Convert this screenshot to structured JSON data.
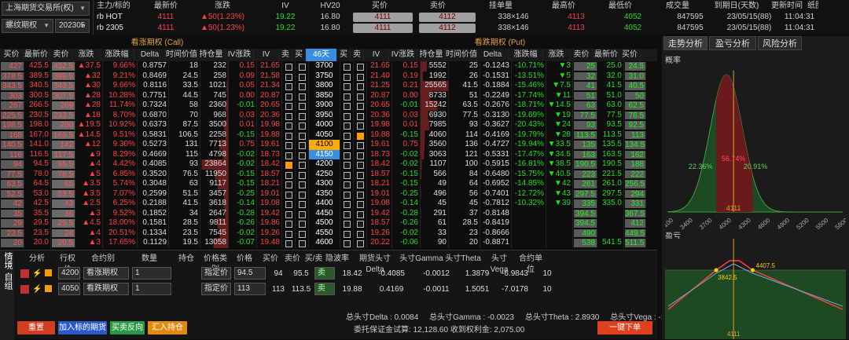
{
  "top": {
    "exchange": "上海期货交易所(权)",
    "type": "螺纹期权",
    "month": "202305",
    "headers": [
      "主力/标的",
      "最新价",
      "涨跌",
      "IV",
      "HV20",
      "买价",
      "卖价",
      "挂单量",
      "最高价",
      "最低价",
      "成交量",
      "到期日(天数)",
      "更新时间",
      "纸图"
    ],
    "rows": [
      {
        "name": "rb HOT",
        "last": "4111",
        "chg": "▲50(1.23%)",
        "iv": "19.22",
        "hv": "16.80",
        "bid": "4111",
        "ask": "4112",
        "qty": "338×146",
        "high": "4113",
        "low": "4052",
        "vol": "847595",
        "exp": "23/05/15(88)",
        "time": "11:04:31"
      },
      {
        "name": "rb 2305",
        "last": "4111",
        "chg": "▲50(1.23%)",
        "iv": "19.22",
        "hv": "16.80",
        "bid": "4111",
        "ask": "4112",
        "qty": "338×146",
        "high": "4113",
        "low": "4052",
        "vol": "847595",
        "exp": "23/05/15(88)",
        "time": "11:04:31"
      }
    ]
  },
  "table": {
    "call_title": "看涨期权 (Call)",
    "put_title": "看跌期权 (Put)",
    "headers": [
      "买价",
      "最新价",
      "卖价",
      "涨跌",
      "涨跌幅",
      "Delta",
      "时间价值",
      "持仓量",
      "IV涨跌",
      "IV",
      "卖",
      "买",
      "46天",
      "买",
      "卖",
      "IV",
      "IV涨跌",
      "持仓量",
      "时间价值",
      "Delta",
      "涨跌幅",
      "涨跌",
      "卖价",
      "最新价",
      "买价"
    ],
    "rows": [
      [
        "427",
        "425.5",
        "432.5",
        "▲37.5",
        "9.66%",
        "0.8757",
        "18",
        "232",
        "0.15",
        "21.65",
        "3700",
        "21.65",
        "0.15",
        "5552",
        "25",
        "-0.1243",
        "-10.71%",
        "▼3",
        "25",
        "25.0",
        "24.5"
      ],
      [
        "378.5",
        "389.5",
        "389.5",
        "▲32",
        "9.21%",
        "0.8469",
        "24.5",
        "258",
        "0.09",
        "21.58",
        "3750",
        "21.40",
        "0.19",
        "1992",
        "26",
        "-0.1531",
        "-13.51%",
        "▼5",
        "32",
        "32.0",
        "31.0"
      ],
      [
        "343.5",
        "340.5",
        "343.5",
        "▲30",
        "9.66%",
        "0.8116",
        "33.5",
        "1021",
        "0.05",
        "21.34",
        "3800",
        "21.25",
        "0.21",
        "25565",
        "41.5",
        "-0.1884",
        "-15.46%",
        "▼7.5",
        "41",
        "41.5",
        "40.5"
      ],
      [
        "303",
        "300.5",
        "307.5",
        "▲28",
        "10.28%",
        "0.7751",
        "44.5",
        "745",
        "0.00",
        "20.87",
        "3850",
        "20.87",
        "0.00",
        "8733",
        "51",
        "-0.2249",
        "-17.74%",
        "▼11",
        "51",
        "51.0",
        "50"
      ],
      [
        "267",
        "266.5",
        "269",
        "▲28",
        "11.74%",
        "0.7324",
        "58",
        "2360",
        "-0.01",
        "20.65",
        "3900",
        "20.65",
        "-0.01",
        "15242",
        "63.5",
        "-0.2676",
        "-18.71%",
        "▼14.5",
        "63",
        "63.0",
        "62.5"
      ],
      [
        "225.5",
        "230.5",
        "233.5",
        "▲18",
        "8.70%",
        "0.6870",
        "70",
        "968",
        "0.03",
        "20.36",
        "3950",
        "20.36",
        "0.03",
        "6930",
        "77.5",
        "-0.3130",
        "-19.69%",
        "▼19",
        "77.5",
        "77.5",
        "76.5"
      ],
      [
        "198.5",
        "198.0",
        "200",
        "▲19.5",
        "10.92%",
        "0.6373",
        "87.5",
        "3500",
        "0.01",
        "19.98",
        "4000",
        "19.98",
        "0.01",
        "7985",
        "93",
        "-0.3627",
        "-20.43%",
        "▼24",
        "93",
        "93.5",
        "92.5"
      ],
      [
        "168",
        "167.0",
        "169.5",
        "▲14.5",
        "9.51%",
        "0.5831",
        "106.5",
        "2258",
        "-0.15",
        "19.88",
        "4050",
        "19.88",
        "-0.15",
        "4060",
        "114",
        "-0.4169",
        "-19.79%",
        "▼28",
        "113.5",
        "113.5",
        "113"
      ],
      [
        "140.5",
        "141.0",
        "142",
        "▲12",
        "9.30%",
        "0.5273",
        "131",
        "7713",
        "0.75",
        "19.61",
        "4100",
        "19.61",
        "0.75",
        "3560",
        "136",
        "-0.4727",
        "-19.94%",
        "▼33.5",
        "135",
        "135.5",
        "134.5"
      ],
      [
        "116",
        "116.5",
        "117.5",
        "▲9",
        "8.29%",
        "0.4669",
        "115",
        "4798",
        "-0.02",
        "18.73",
        "4150",
        "18.73",
        "-0.02",
        "3063",
        "121",
        "-0.5331",
        "-17.47%",
        "▼34.5",
        "163",
        "163.5",
        "162"
      ],
      [
        "94",
        "94.5",
        "95.5",
        "▲4",
        "4.42%",
        "0.4085",
        "93",
        "23864",
        "-0.02",
        "18.42",
        "4200",
        "18.42",
        "-0.02",
        "1107",
        "100",
        "-0.5915",
        "-16.81%",
        "▼38.5",
        "190.5",
        "190.5",
        "188"
      ],
      [
        "77.5",
        "78.0",
        "78.5",
        "▲5",
        "6.85%",
        "0.3520",
        "76.5",
        "11950",
        "-0.15",
        "18.57",
        "4250",
        "18.57",
        "-0.15",
        "566",
        "84",
        "-0.6480",
        "-15.75%",
        "▼40.5",
        "223",
        "221.5",
        "222"
      ],
      [
        "63.5",
        "64.5",
        "65",
        "▲3.5",
        "5.74%",
        "0.3048",
        "63",
        "9117",
        "-0.15",
        "18.21",
        "4300",
        "18.21",
        "-0.15",
        "49",
        "64",
        "-0.6952",
        "-14.85%",
        "▼42",
        "261",
        "261.0",
        "256.5"
      ],
      [
        "52.5",
        "53.0",
        "53.5",
        "▲3.5",
        "7.07%",
        "0.2599",
        "51.5",
        "3457",
        "-0.25",
        "19.01",
        "4350",
        "19.01",
        "-0.25",
        "496",
        "56",
        "-0.7401",
        "-12.72%",
        "▼43",
        "297.5",
        "297.5",
        "294"
      ],
      [
        "42",
        "42.5",
        "43",
        "▲2.5",
        "6.25%",
        "0.2188",
        "41.5",
        "3618",
        "-0.14",
        "19.08",
        "4400",
        "19.08",
        "-0.14",
        "45",
        "45",
        "-0.7812",
        "-10.32%",
        "▼39",
        "335",
        "335.0",
        "331"
      ],
      [
        "35",
        "35.5",
        "36",
        "▲3",
        "9.52%",
        "0.1852",
        "34",
        "2647",
        "-0.28",
        "19.42",
        "4450",
        "19.42",
        "-0.28",
        "291",
        "37",
        "-0.8148",
        "",
        "",
        "394.5",
        "",
        "367.5"
      ],
      [
        "29",
        "29.5",
        "29.5",
        "▲4.5",
        "18.00%",
        "0.1581",
        "28.5",
        "9811",
        "-0.26",
        "19.86",
        "4500",
        "18.57",
        "-0.26",
        "61",
        "28.5",
        "-0.8419",
        "",
        "",
        "394.5",
        "",
        "412"
      ],
      [
        "23.5",
        "23.5",
        "24",
        "▲4",
        "20.51%",
        "0.1334",
        "23.5",
        "7545",
        "-0.02",
        "19.26",
        "4550",
        "19.26",
        "-0.02",
        "33",
        "23",
        "-0.8666",
        "",
        "",
        "490",
        "",
        "449.5"
      ],
      [
        "20",
        "20.0",
        "20.5",
        "▲3",
        "17.65%",
        "0.1129",
        "19.5",
        "13058",
        "-0.07",
        "19.48",
        "4600",
        "20.22",
        "-0.06",
        "90",
        "20",
        "-0.8871",
        "",
        "",
        "538",
        "541.5",
        "511.5"
      ]
    ]
  },
  "order": {
    "headers": [
      "分析",
      "行权价",
      "合约别",
      "数量",
      "持仓",
      "价格类别",
      "价格",
      "买价",
      "卖价",
      "买/卖",
      "隐波率",
      "期货头寸Delta",
      "头寸Gamma",
      "头寸Theta",
      "头寸Vega",
      "合约单位"
    ],
    "rows": [
      {
        "strike": "4200",
        "type": "看涨期权",
        "qty": "1",
        "ptype": "指定价",
        "price": "94.5",
        "bid": "94",
        "ask": "95.5",
        "side": "卖",
        "iv": "18.42",
        "delta": "-0.4085",
        "gamma": "-0.0012",
        "theta": "1.3879",
        "vega": "-6.9843",
        "unit": "10"
      },
      {
        "strike": "4050",
        "type": "看跌期权",
        "qty": "1",
        "ptype": "指定价",
        "price": "113",
        "bid": "113",
        "ask": "113.5",
        "side": "卖",
        "iv": "19.88",
        "delta": "0.4169",
        "gamma": "-0.0011",
        "theta": "1.5051",
        "vega": "-7.0178",
        "unit": "10"
      }
    ],
    "side_tabs": [
      "情境",
      "自组"
    ],
    "totals": "总头寸Delta : 0.0084     总头寸Gamma : -0.0023     总头寸Theta : 2.8930     总头寸Vega : -14.0021",
    "margin": "委托保证金试算: 12,128.60  收到权利金: 2,075.00",
    "buttons": {
      "reset": "重置",
      "add": "加入标的期货",
      "reverse": "买卖反向",
      "import": "汇入持仓",
      "submit": "一键下单"
    }
  },
  "right": {
    "tabs": [
      "走势分析",
      "盈亏分析",
      "风险分析"
    ],
    "prob_title": "概率",
    "pl_title": "盈亏",
    "pct_left": "22.36%",
    "pct_mid": "56.74%",
    "pct_right": "20.91%",
    "xticks": [
      "3100",
      "3400",
      "3700",
      "4000",
      "4300",
      "4600",
      "4900",
      "5200",
      "5500",
      "5800"
    ],
    "price_mark": "4111",
    "be_left": "3842.5",
    "be_right": "4407.5"
  },
  "colors": {
    "up": "#ff4040",
    "down": "#22dd22",
    "accent": "#ff9900",
    "bg": "#0d0d0d"
  }
}
